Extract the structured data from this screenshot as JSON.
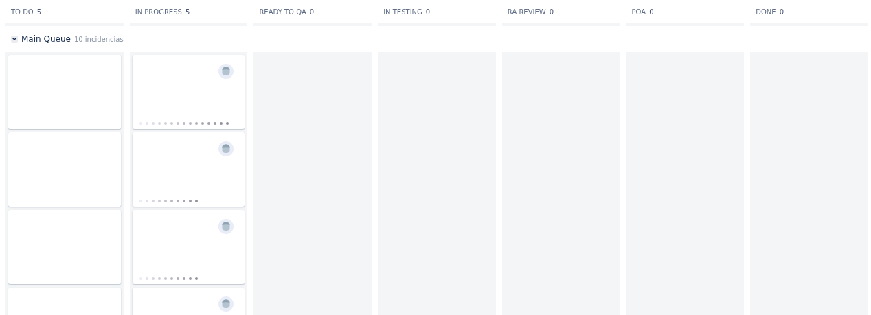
{
  "columns": [
    {
      "title": "TO DO",
      "count": "5",
      "cards": [
        {
          "avatar": false,
          "kind": "blank"
        },
        {
          "avatar": false,
          "kind": "blank"
        },
        {
          "avatar": false,
          "kind": "blank"
        },
        {
          "avatar": false,
          "kind": "blank"
        }
      ]
    },
    {
      "title": "IN PROGRESS",
      "count": "5",
      "cards": [
        {
          "avatar": true,
          "kind": "long"
        },
        {
          "avatar": true,
          "kind": "short"
        },
        {
          "avatar": true,
          "kind": "short"
        },
        {
          "avatar": true,
          "kind": "blank"
        }
      ]
    },
    {
      "title": "READY TO QA",
      "count": "0"
    },
    {
      "title": "IN TESTING",
      "count": "0"
    },
    {
      "title": "RA REVIEW",
      "count": "0"
    },
    {
      "title": "POA",
      "count": "0"
    },
    {
      "title": "DONE",
      "count": "0"
    }
  ],
  "swimlane": {
    "expanded": true,
    "title": "Main Queue",
    "count": "10 incidencias"
  }
}
